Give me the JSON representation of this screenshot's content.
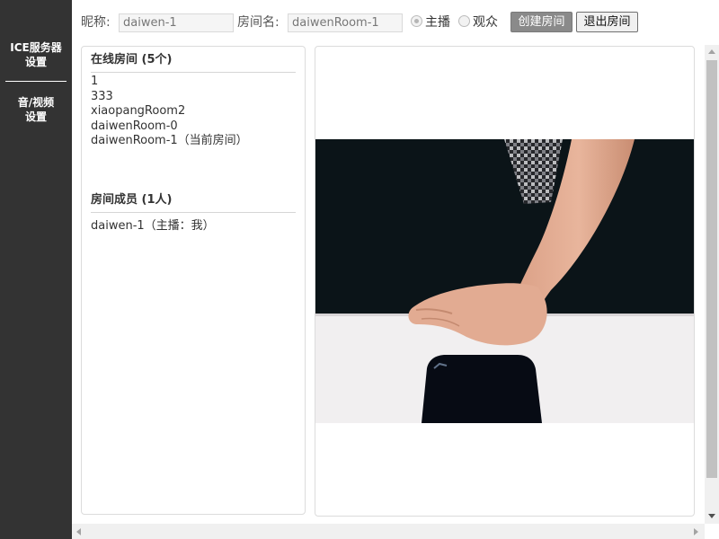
{
  "sidebar": {
    "items": [
      {
        "line1": "ICE服务器",
        "line2": "设置"
      },
      {
        "line1": "音/视频",
        "line2": "设置"
      }
    ]
  },
  "toolbar": {
    "nickname_label": "昵称:",
    "nickname_value": "daiwen-1",
    "room_label": "房间名:",
    "room_value": "daiwenRoom-1",
    "role_host": "主播",
    "role_audience": "观众",
    "selected_role": "主播",
    "create_label": "创建房间",
    "exit_label": "退出房间"
  },
  "online_rooms": {
    "title": "在线房间 (5个)",
    "items": [
      "1",
      "333",
      "xiaopangRoom2",
      "daiwenRoom-0",
      "daiwenRoom-1（当前房间）"
    ]
  },
  "members": {
    "title": "房间成员 (1人)",
    "items": [
      "daiwen-1（主播：我）"
    ]
  },
  "colors": {
    "sidebar_bg": "#333333",
    "create_button_bg": "#8a8a8a",
    "video_dark": "#0b1418",
    "video_table": "#f1eff0",
    "skin": "#e2ab92"
  },
  "icons": {
    "scroll_up": "triangle-up",
    "scroll_down": "triangle-down",
    "scroll_left": "triangle-left",
    "scroll_right": "triangle-right"
  }
}
